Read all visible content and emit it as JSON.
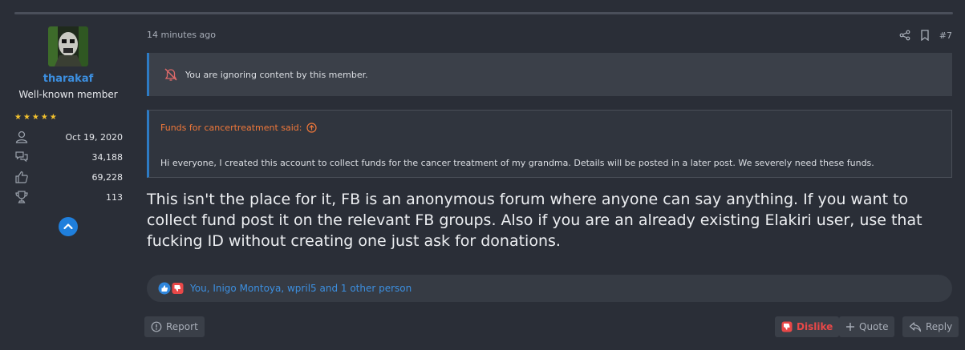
{
  "user": {
    "name": "tharakaf",
    "title": "Well-known member",
    "joined": "Oct 19, 2020",
    "messages": "34,188",
    "reactions": "69,228",
    "points": "113",
    "rating_stars": 5
  },
  "post": {
    "time": "14 minutes ago",
    "number": "#7",
    "ignored_notice": "You are ignoring content by this member.",
    "quote_author": "Funds for cancertreatment said:",
    "quote_text": "Hi everyone, I created this account to collect funds for the cancer treatment of my grandma. Details will be posted in a later post. We severely need these funds.",
    "message_lines": [
      "This isn't the place for it, FB is an anonymous forum where anyone can say anything. If you want to",
      "collect fund post it on the relevant FB groups. Also if you are an already existing Elakiri user, use that",
      "fucking ID without creating one just ask for donations."
    ],
    "reactions_text": "You, Inigo Montoya, wpril5 and 1 other person"
  },
  "actions": {
    "report": "Report",
    "dislike": "Dislike",
    "quote": "Quote",
    "reply": "Reply"
  },
  "colors": {
    "accent": "#3c8fe0",
    "quote_author": "#f0783a",
    "dislike": "#e94848",
    "stars": "#f2c12e"
  }
}
